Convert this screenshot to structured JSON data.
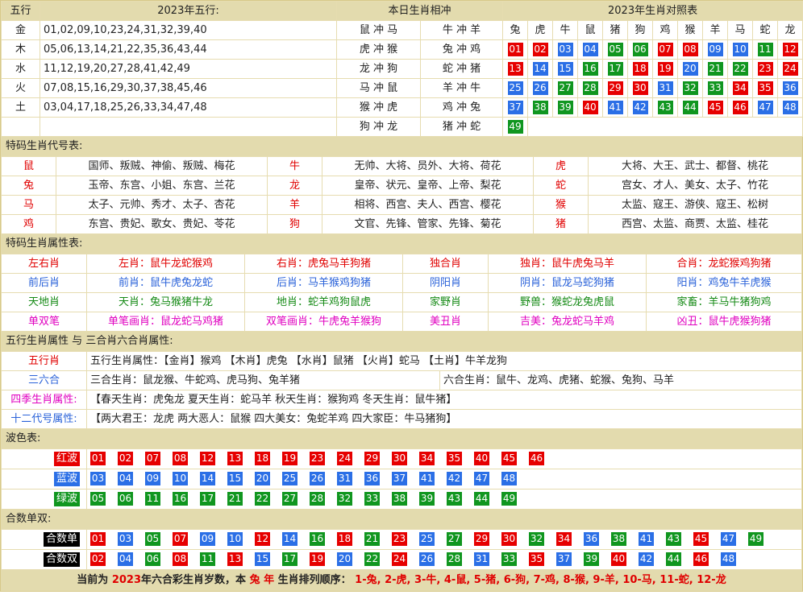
{
  "wuxing": {
    "header": {
      "c1": "五行",
      "c2": "2023年五行:",
      "c3": "本日生肖相冲",
      "c4": "2023年生肖对照表"
    },
    "rows": [
      {
        "el": "金",
        "nums": "01,02,09,10,23,24,31,32,39,40",
        "ca": "鼠 冲 马",
        "cb": "牛 冲 羊"
      },
      {
        "el": "木",
        "nums": "05,06,13,14,21,22,35,36,43,44",
        "ca": "虎 冲 猴",
        "cb": "兔 冲 鸡"
      },
      {
        "el": "水",
        "nums": "11,12,19,20,27,28,41,42,49",
        "ca": "龙 冲 狗",
        "cb": "蛇 冲 猪"
      },
      {
        "el": "火",
        "nums": "07,08,15,16,29,30,37,38,45,46",
        "ca": "马 冲 鼠",
        "cb": "羊 冲 牛"
      },
      {
        "el": "土",
        "nums": "03,04,17,18,25,26,33,34,47,48",
        "ca": "猴 冲 虎",
        "cb": "鸡 冲 兔"
      },
      {
        "el": "",
        "nums": "",
        "ca": "狗 冲 龙",
        "cb": "猪 冲 蛇"
      }
    ],
    "zodiac_header": [
      "兔",
      "虎",
      "牛",
      "鼠",
      "猪",
      "狗",
      "鸡",
      "猴",
      "羊",
      "马",
      "蛇",
      "龙"
    ],
    "grid": [
      [
        [
          "01",
          "r"
        ],
        [
          "02",
          "r"
        ],
        [
          "03",
          "bl"
        ],
        [
          "04",
          "bl"
        ],
        [
          "05",
          "g"
        ],
        [
          "06",
          "g"
        ],
        [
          "07",
          "r"
        ],
        [
          "08",
          "r"
        ],
        [
          "09",
          "bl"
        ],
        [
          "10",
          "bl"
        ],
        [
          "11",
          "g"
        ],
        [
          "12",
          "r"
        ]
      ],
      [
        [
          "13",
          "r"
        ],
        [
          "14",
          "bl"
        ],
        [
          "15",
          "bl"
        ],
        [
          "16",
          "g"
        ],
        [
          "17",
          "g"
        ],
        [
          "18",
          "r"
        ],
        [
          "19",
          "r"
        ],
        [
          "20",
          "bl"
        ],
        [
          "21",
          "g"
        ],
        [
          "22",
          "g"
        ],
        [
          "23",
          "r"
        ],
        [
          "24",
          "r"
        ]
      ],
      [
        [
          "25",
          "bl"
        ],
        [
          "26",
          "bl"
        ],
        [
          "27",
          "g"
        ],
        [
          "28",
          "g"
        ],
        [
          "29",
          "r"
        ],
        [
          "30",
          "r"
        ],
        [
          "31",
          "bl"
        ],
        [
          "32",
          "g"
        ],
        [
          "33",
          "g"
        ],
        [
          "34",
          "r"
        ],
        [
          "35",
          "r"
        ],
        [
          "36",
          "bl"
        ]
      ],
      [
        [
          "37",
          "bl"
        ],
        [
          "38",
          "g"
        ],
        [
          "39",
          "g"
        ],
        [
          "40",
          "r"
        ],
        [
          "41",
          "bl"
        ],
        [
          "42",
          "bl"
        ],
        [
          "43",
          "g"
        ],
        [
          "44",
          "g"
        ],
        [
          "45",
          "r"
        ],
        [
          "46",
          "r"
        ],
        [
          "47",
          "bl"
        ],
        [
          "48",
          "bl"
        ]
      ],
      [
        [
          "49",
          "g"
        ]
      ]
    ]
  },
  "codes": {
    "title": "特码生肖代号表:",
    "rows": [
      [
        [
          "鼠",
          "国师、叛贼、神偷、叛贼、梅花"
        ],
        [
          "牛",
          "无帅、大将、员外、大将、荷花"
        ],
        [
          "虎",
          "大将、大王、武士、都督、桃花"
        ]
      ],
      [
        [
          "兔",
          "玉帝、东宫、小姐、东宫、兰花"
        ],
        [
          "龙",
          "皇帝、状元、皇帝、上帝、梨花"
        ],
        [
          "蛇",
          "宫女、才人、美女、太子、竹花"
        ]
      ],
      [
        [
          "马",
          "太子、元帅、秀才、太子、杏花"
        ],
        [
          "羊",
          "相将、西宫、夫人、西宫、樱花"
        ],
        [
          "猴",
          "太监、寇王、游侠、寇王、松树"
        ]
      ],
      [
        [
          "鸡",
          "东宫、贵妃、歌女、贵妃、苓花"
        ],
        [
          "狗",
          "文官、先锋、管家、先锋、菊花"
        ],
        [
          "猪",
          "西宫、太监、商贾、太监、桂花"
        ]
      ]
    ]
  },
  "attrs": {
    "title": "特码生肖属性表:",
    "rows": [
      {
        "cls": "red",
        "a": "左右肖",
        "b1": "左肖：鼠牛龙蛇猴鸡",
        "b2": "右肖：虎兔马羊狗猪",
        "c": "独合肖",
        "d1": "独肖：鼠牛虎兔马羊",
        "d2": "合肖：龙蛇猴鸡狗猪"
      },
      {
        "cls": "blue",
        "a": "前后肖",
        "b1": "前肖：鼠牛虎兔龙蛇",
        "b2": "后肖：马羊猴鸡狗猪",
        "c": "阴阳肖",
        "d1": "阴肖：鼠龙马蛇狗猪",
        "d2": "阳肖：鸡兔牛羊虎猴"
      },
      {
        "cls": "green",
        "a": "天地肖",
        "b1": "天肖：兔马猴猪牛龙",
        "b2": "地肖：蛇羊鸡狗鼠虎",
        "c": "家野肖",
        "d1": "野兽：猴蛇龙兔虎鼠",
        "d2": "家畜：羊马牛猪狗鸡"
      },
      {
        "cls": "pink",
        "a": "单双笔",
        "b1": "单笔画肖：鼠龙蛇马鸡猪",
        "b2": "双笔画肖：牛虎兔羊猴狗",
        "c": "美丑肖",
        "d1": "吉美：兔龙蛇马羊鸡",
        "d2": "凶丑：鼠牛虎猴狗猪"
      }
    ]
  },
  "five": {
    "title": "五行生肖属性 与 三合肖六合肖属性:",
    "wx_label": "五行肖",
    "wx_text": "五行生肖属性：【金肖】猴鸡 【木肖】虎兔 【水肖】鼠猪 【火肖】蛇马 【土肖】牛羊龙狗",
    "sh_label": "三六合",
    "sh_a": "三合生肖：鼠龙猴、牛蛇鸡、虎马狗、兔羊猪",
    "sh_b": "六合生肖：鼠牛、龙鸡、虎猪、蛇猴、兔狗、马羊",
    "sj_label": "四季生肖属性:",
    "sj_text": "【春天生肖：虎兔龙 夏天生肖：蛇马羊 秋天生肖：猴狗鸡 冬天生肖：鼠牛猪】",
    "se_label": "十二代号属性:",
    "se_text": "【两大君王：龙虎 两大恶人：鼠猴 四大美女：兔蛇羊鸡 四大家臣：牛马猪狗】"
  },
  "waves": {
    "title": "波色表:",
    "rows": [
      {
        "label": "红波",
        "color": "r",
        "nums": [
          "01",
          "02",
          "07",
          "08",
          "12",
          "13",
          "18",
          "19",
          "23",
          "24",
          "29",
          "30",
          "34",
          "35",
          "40",
          "45",
          "46"
        ]
      },
      {
        "label": "蓝波",
        "color": "bl",
        "nums": [
          "03",
          "04",
          "09",
          "10",
          "14",
          "15",
          "20",
          "25",
          "26",
          "31",
          "36",
          "37",
          "41",
          "42",
          "47",
          "48"
        ]
      },
      {
        "label": "绿波",
        "color": "g",
        "nums": [
          "05",
          "06",
          "11",
          "16",
          "17",
          "21",
          "22",
          "27",
          "28",
          "32",
          "33",
          "38",
          "39",
          "43",
          "44",
          "49"
        ]
      }
    ]
  },
  "parity": {
    "title": "合数单双:",
    "rows": [
      {
        "label": "合数单",
        "nums": [
          [
            "01",
            "r"
          ],
          [
            "03",
            "bl"
          ],
          [
            "05",
            "g"
          ],
          [
            "07",
            "r"
          ],
          [
            "09",
            "bl"
          ],
          [
            "10",
            "bl"
          ],
          [
            "12",
            "r"
          ],
          [
            "14",
            "bl"
          ],
          [
            "16",
            "g"
          ],
          [
            "18",
            "r"
          ],
          [
            "21",
            "g"
          ],
          [
            "23",
            "r"
          ],
          [
            "25",
            "bl"
          ],
          [
            "27",
            "g"
          ],
          [
            "29",
            "r"
          ],
          [
            "30",
            "r"
          ],
          [
            "32",
            "g"
          ],
          [
            "34",
            "r"
          ],
          [
            "36",
            "bl"
          ],
          [
            "38",
            "g"
          ],
          [
            "41",
            "bl"
          ],
          [
            "43",
            "g"
          ],
          [
            "45",
            "r"
          ],
          [
            "47",
            "bl"
          ],
          [
            "49",
            "g"
          ]
        ]
      },
      {
        "label": "合数双",
        "nums": [
          [
            "02",
            "r"
          ],
          [
            "04",
            "bl"
          ],
          [
            "06",
            "g"
          ],
          [
            "08",
            "r"
          ],
          [
            "11",
            "g"
          ],
          [
            "13",
            "r"
          ],
          [
            "15",
            "bl"
          ],
          [
            "17",
            "g"
          ],
          [
            "19",
            "r"
          ],
          [
            "20",
            "bl"
          ],
          [
            "22",
            "g"
          ],
          [
            "24",
            "r"
          ],
          [
            "26",
            "bl"
          ],
          [
            "28",
            "g"
          ],
          [
            "31",
            "bl"
          ],
          [
            "33",
            "g"
          ],
          [
            "35",
            "r"
          ],
          [
            "37",
            "bl"
          ],
          [
            "39",
            "g"
          ],
          [
            "40",
            "r"
          ],
          [
            "42",
            "bl"
          ],
          [
            "44",
            "g"
          ],
          [
            "46",
            "r"
          ],
          [
            "48",
            "bl"
          ]
        ]
      }
    ]
  },
  "footer": {
    "a": "当前为",
    "year": "2023",
    "b": "年六合彩生肖岁数，本",
    "zodiac": "兔 年",
    "c": "生肖排列顺序：",
    "order": "1-兔, 2-虎, 3-牛, 4-鼠, 5-猪, 6-狗, 7-鸡, 8-猴, 9-羊, 10-马, 11-蛇, 12-龙"
  }
}
